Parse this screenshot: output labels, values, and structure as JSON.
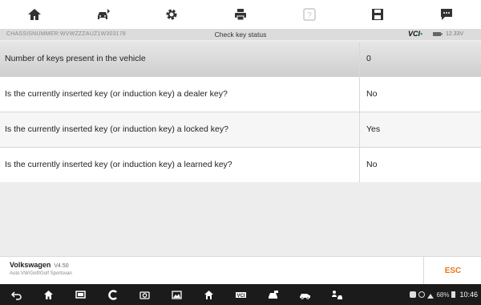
{
  "toolbar": {
    "buttons": [
      {
        "icon": "home-icon"
      },
      {
        "icon": "car-switch-icon"
      },
      {
        "icon": "settings-gear-icon"
      },
      {
        "icon": "print-icon"
      },
      {
        "icon": "help-icon",
        "disabled": true
      },
      {
        "icon": "save-icon"
      },
      {
        "icon": "message-icon"
      }
    ]
  },
  "infobar": {
    "vin": "CHASSISNUMMER:WVWZZZAUZ1W303178",
    "title": "Check key status",
    "vci_label": "VCI",
    "vci_status_color": "#29a845",
    "voltage": "12.33V"
  },
  "table": {
    "header": {
      "question": "Number of keys present in the vehicle",
      "answer": "0"
    },
    "rows": [
      {
        "question": "Is the currently inserted key (or induction key) a dealer key?",
        "answer": "No"
      },
      {
        "question": "Is the currently inserted key (or induction key) a locked key?",
        "answer": "Yes"
      },
      {
        "question": "Is the currently inserted key (or induction key) a learned key?",
        "answer": "No"
      }
    ]
  },
  "footer": {
    "make": "Volkswagen",
    "version": "V4.50",
    "path": "Auto:VW/Golf/Golf Sportsvan",
    "esc_label": "ESC",
    "esc_color": "#e8761c"
  },
  "navbar": {
    "icons": [
      "back-icon",
      "home-icon",
      "recent-apps-icon",
      "browser-icon",
      "camera-icon",
      "image-icon",
      "maxifix-home-icon",
      "vci-icon",
      "car-icon",
      "car-side-icon",
      "people-car-icon"
    ],
    "status": {
      "battery": "68%",
      "time": "10:46"
    }
  }
}
